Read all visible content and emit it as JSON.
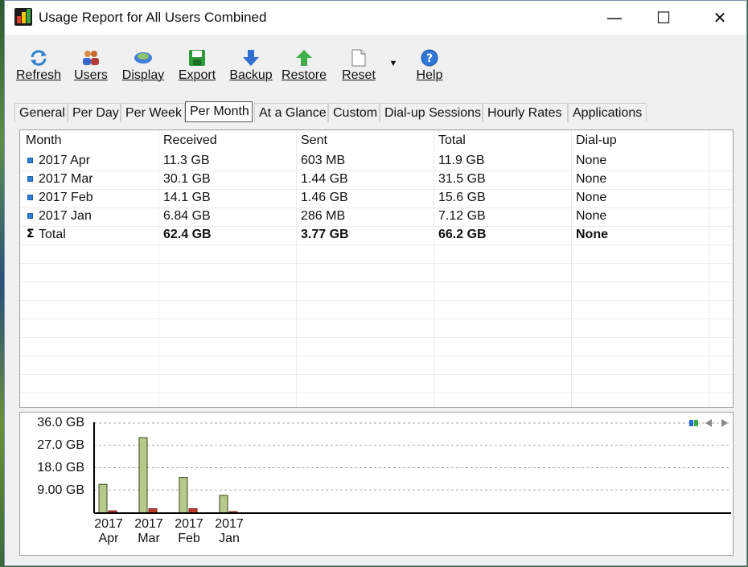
{
  "window": {
    "title": "Usage Report for All Users Combined"
  },
  "titlebar_buttons": {
    "minimize": "—",
    "maximize": "☐",
    "close": "✕"
  },
  "toolbar": {
    "buttons": [
      {
        "label": "Refresh",
        "icon": "refresh-icon"
      },
      {
        "label": "Users",
        "icon": "users-icon"
      },
      {
        "label": "Display",
        "icon": "display-icon"
      },
      {
        "label": "Export",
        "icon": "export-icon"
      },
      {
        "label": "Backup",
        "icon": "backup-icon"
      },
      {
        "label": "Restore",
        "icon": "restore-icon"
      },
      {
        "label": "Reset",
        "icon": "reset-icon"
      },
      {
        "label": "Help",
        "icon": "help-icon"
      }
    ],
    "dropdown_glyph": "▼"
  },
  "tabs": [
    "General",
    "Per Day",
    "Per Week",
    "Per Month",
    "At a Glance",
    "Custom",
    "Dial-up Sessions",
    "Hourly Rates",
    "Applications"
  ],
  "active_tab": "Per Month",
  "table": {
    "headers": [
      "Month",
      "Received",
      "Sent",
      "Total",
      "Dial-up"
    ],
    "rows": [
      [
        "2017 Apr",
        "11.3 GB",
        "603 MB",
        "11.9 GB",
        "None"
      ],
      [
        "2017 Mar",
        "30.1 GB",
        "1.44 GB",
        "31.5 GB",
        "None"
      ],
      [
        "2017 Feb",
        "14.1 GB",
        "1.46 GB",
        "15.6 GB",
        "None"
      ],
      [
        "2017 Jan",
        "6.84 GB",
        "286 MB",
        "7.12 GB",
        "None"
      ]
    ],
    "total": {
      "sigma": "Σ",
      "label": "Total",
      "received": "62.4 GB",
      "sent": "3.77 GB",
      "total": "66.2 GB",
      "dialup": "None"
    }
  },
  "chart_data": {
    "type": "bar",
    "categories": [
      "2017 Apr",
      "2017 Mar",
      "2017 Feb",
      "2017 Jan"
    ],
    "series": [
      {
        "values": [
          11.3,
          30.1,
          14.1,
          6.84
        ],
        "color": "#b6c98a"
      },
      {
        "values": [
          0.603,
          1.44,
          1.46,
          0.286
        ],
        "color": "#c23a2e"
      }
    ],
    "yticks": [
      "36.0 GB",
      "27.0 GB",
      "18.0 GB",
      "9.00 GB"
    ],
    "ylim": [
      0,
      36
    ],
    "grid": true,
    "legend_icons": [
      "chart-icon",
      "back-icon",
      "forward-icon"
    ]
  }
}
